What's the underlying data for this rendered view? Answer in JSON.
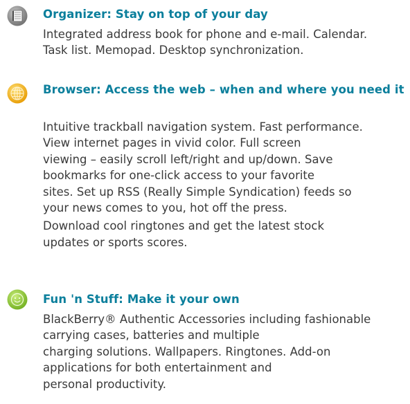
{
  "sections": [
    {
      "icon": "organizer-icon",
      "heading": [
        "Organizer: Stay on top of your day"
      ],
      "body": [
        "Integrated address book for phone and e-mail. Calendar.",
        "Task list. Memopad. Desktop synchronization."
      ]
    },
    {
      "icon": "browser-globe-icon",
      "heading": [
        "Browser: Access the web –",
        "when and where you need it"
      ],
      "body": [
        "Intuitive trackball navigation system. Fast performance.",
        "View internet pages in vivid color. Full screen",
        "viewing – easily scroll left/right and up/down. Save",
        "bookmarks for one-click access to your favorite",
        "sites. Set up RSS (Really Simple Syndication) feeds so",
        "your news comes to you, hot off the press.",
        "Download cool ringtones and get the latest stock",
        "updates or sports scores."
      ]
    },
    {
      "icon": "smiley-face-icon",
      "heading": [
        "Fun 'n Stuff: Make it your own"
      ],
      "body": [
        "BlackBerry® Authentic Accessories including fashionable",
        "carrying cases, batteries and multiple",
        "charging solutions. Wallpapers. Ringtones. Add-on",
        "applications for both entertainment and",
        "personal productivity."
      ]
    }
  ],
  "colors": {
    "heading": "#0b7f9c",
    "body": "#3a3a3a",
    "organizer_icon": "#8a8a8a",
    "browser_icon": "#f2a900",
    "fun_icon": "#8dc63f"
  }
}
